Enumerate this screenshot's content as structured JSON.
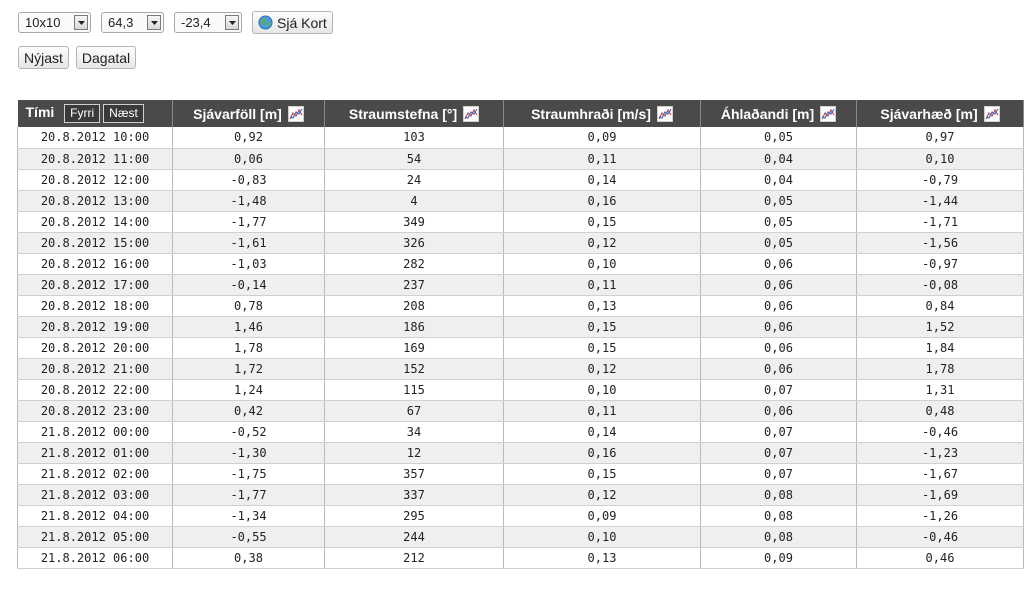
{
  "controls": {
    "grid_select": "10x10",
    "lat_select": "64,3",
    "lon_select": "-23,4",
    "map_button": "Sjá Kort",
    "latest_button": "Nýjast",
    "calendar_button": "Dagatal"
  },
  "table": {
    "time_header": "Tími",
    "prev_label": "Fyrri",
    "next_label": "Næst",
    "columns": [
      "Sjávarföll [m]",
      "Straumstefna [°]",
      "Straumhraði [m/s]",
      "Áhlaðandi [m]",
      "Sjávarhæð [m]"
    ],
    "rows": [
      [
        "20.8.2012 10:00",
        "0,92",
        "103",
        "0,09",
        "0,05",
        "0,97"
      ],
      [
        "20.8.2012 11:00",
        "0,06",
        "54",
        "0,11",
        "0,04",
        "0,10"
      ],
      [
        "20.8.2012 12:00",
        "-0,83",
        "24",
        "0,14",
        "0,04",
        "-0,79"
      ],
      [
        "20.8.2012 13:00",
        "-1,48",
        "4",
        "0,16",
        "0,05",
        "-1,44"
      ],
      [
        "20.8.2012 14:00",
        "-1,77",
        "349",
        "0,15",
        "0,05",
        "-1,71"
      ],
      [
        "20.8.2012 15:00",
        "-1,61",
        "326",
        "0,12",
        "0,05",
        "-1,56"
      ],
      [
        "20.8.2012 16:00",
        "-1,03",
        "282",
        "0,10",
        "0,06",
        "-0,97"
      ],
      [
        "20.8.2012 17:00",
        "-0,14",
        "237",
        "0,11",
        "0,06",
        "-0,08"
      ],
      [
        "20.8.2012 18:00",
        "0,78",
        "208",
        "0,13",
        "0,06",
        "0,84"
      ],
      [
        "20.8.2012 19:00",
        "1,46",
        "186",
        "0,15",
        "0,06",
        "1,52"
      ],
      [
        "20.8.2012 20:00",
        "1,78",
        "169",
        "0,15",
        "0,06",
        "1,84"
      ],
      [
        "20.8.2012 21:00",
        "1,72",
        "152",
        "0,12",
        "0,06",
        "1,78"
      ],
      [
        "20.8.2012 22:00",
        "1,24",
        "115",
        "0,10",
        "0,07",
        "1,31"
      ],
      [
        "20.8.2012 23:00",
        "0,42",
        "67",
        "0,11",
        "0,06",
        "0,48"
      ],
      [
        "21.8.2012 00:00",
        "-0,52",
        "34",
        "0,14",
        "0,07",
        "-0,46"
      ],
      [
        "21.8.2012 01:00",
        "-1,30",
        "12",
        "0,16",
        "0,07",
        "-1,23"
      ],
      [
        "21.8.2012 02:00",
        "-1,75",
        "357",
        "0,15",
        "0,07",
        "-1,67"
      ],
      [
        "21.8.2012 03:00",
        "-1,77",
        "337",
        "0,12",
        "0,08",
        "-1,69"
      ],
      [
        "21.8.2012 04:00",
        "-1,34",
        "295",
        "0,09",
        "0,08",
        "-1,26"
      ],
      [
        "21.8.2012 05:00",
        "-0,55",
        "244",
        "0,10",
        "0,08",
        "-0,46"
      ],
      [
        "21.8.2012 06:00",
        "0,38",
        "212",
        "0,13",
        "0,09",
        "0,46"
      ]
    ]
  },
  "icons": {
    "dropdown": "chevron-down-icon",
    "map": "globe-icon",
    "column_chart": "chart-icon"
  }
}
